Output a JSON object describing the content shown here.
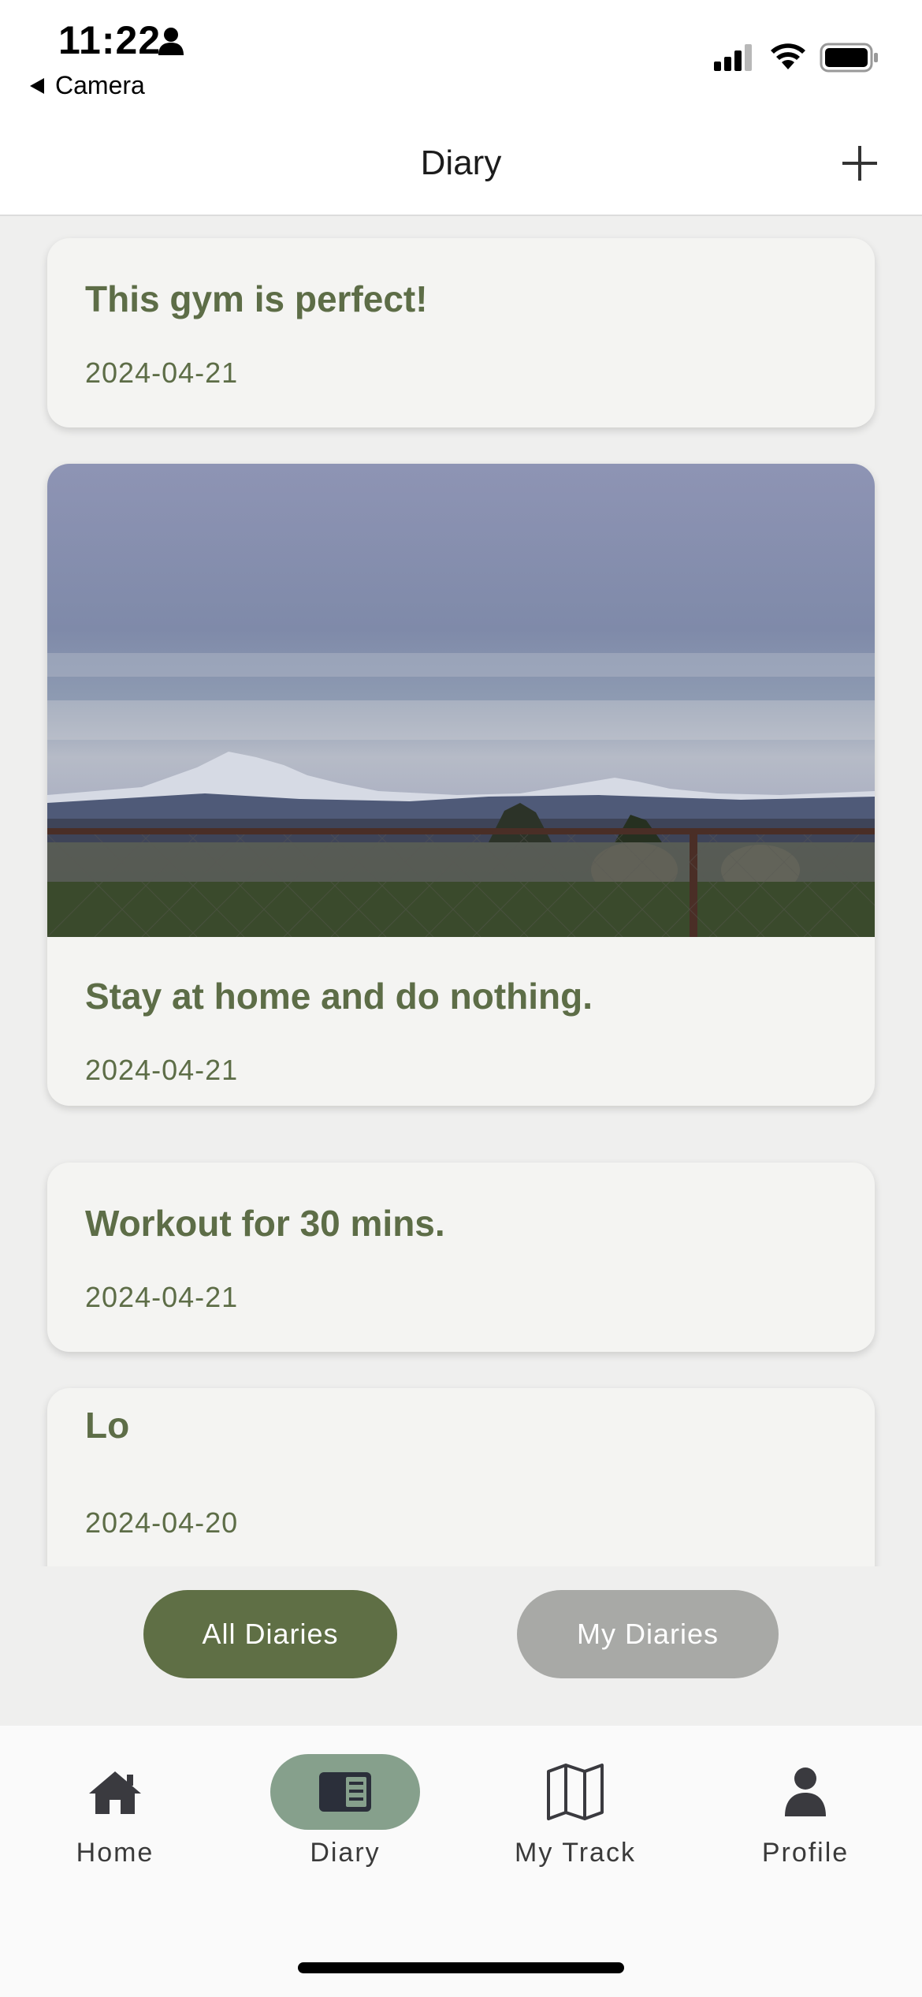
{
  "status_bar": {
    "time": "11:22",
    "back_label": "Camera"
  },
  "nav": {
    "title": "Diary",
    "add_icon": "plus-icon"
  },
  "entries": [
    {
      "title": "This gym is perfect!",
      "date": "2024-04-21",
      "has_photo": false
    },
    {
      "title": "Stay at home and do nothing.",
      "date": "2024-04-21",
      "has_photo": true,
      "photo": "mountain-landscape-photo"
    },
    {
      "title": "Workout for 30 mins.",
      "date": "2024-04-21",
      "has_photo": false
    },
    {
      "title": "Lo",
      "date": "2024-04-20",
      "has_photo": false
    }
  ],
  "filters": {
    "all_label": "All Diaries",
    "my_label": "My Diaries",
    "selected": "All Diaries"
  },
  "tabs": [
    {
      "label": "Home",
      "icon": "home-icon"
    },
    {
      "label": "Diary",
      "icon": "diary-icon",
      "active": true
    },
    {
      "label": "My Track",
      "icon": "map-icon"
    },
    {
      "label": "Profile",
      "icon": "profile-icon"
    }
  ],
  "colors": {
    "accent": "#5f6f45",
    "text_green": "#5d6d47",
    "active_tab": "#86a08c",
    "inactive_button": "#a8a9a6"
  }
}
